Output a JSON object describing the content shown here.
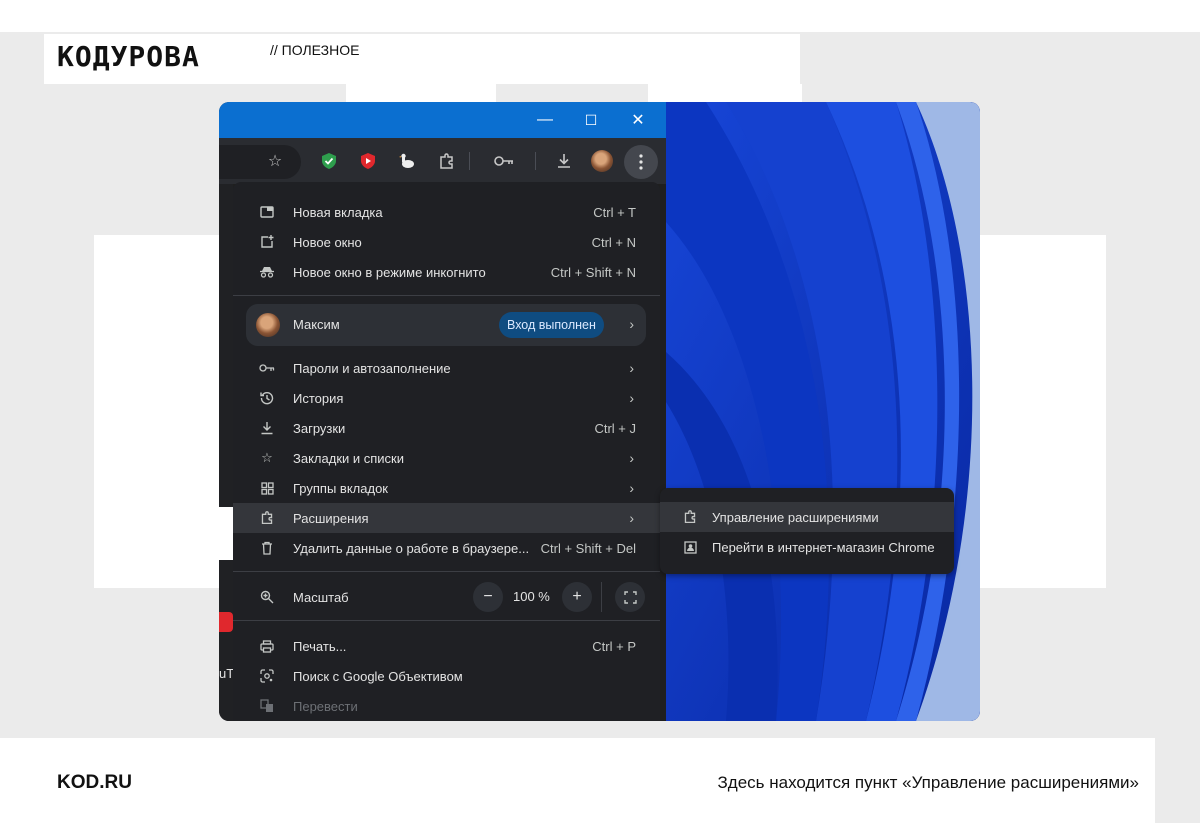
{
  "brand": {
    "logo": "KOДУРОВА",
    "tagline": "// ПОЛЕЗНОЕ"
  },
  "window": {
    "minimize_glyph": "—",
    "maximize_glyph": "☐",
    "close_glyph": "✕"
  },
  "toolbar": {
    "icons": [
      "star-icon",
      "shield-check-icon",
      "youtube-shield-icon",
      "goose-icon",
      "puzzle-icon",
      "key-icon",
      "download-icon",
      "avatar",
      "kebab-icon"
    ]
  },
  "menu": {
    "new_tab": {
      "label": "Новая вкладка",
      "shortcut": "Ctrl + T"
    },
    "new_window": {
      "label": "Новое окно",
      "shortcut": "Ctrl + N"
    },
    "incognito": {
      "label": "Новое окно в режиме инкогнито",
      "shortcut": "Ctrl + Shift + N"
    },
    "profile": {
      "name": "Максим",
      "status": "Вход выполнен"
    },
    "passwords": {
      "label": "Пароли и автозаполнение"
    },
    "history": {
      "label": "История"
    },
    "downloads": {
      "label": "Загрузки",
      "shortcut": "Ctrl + J"
    },
    "bookmarks": {
      "label": "Закладки и списки"
    },
    "tab_groups": {
      "label": "Группы вкладок"
    },
    "extensions": {
      "label": "Расширения"
    },
    "clear_data": {
      "label": "Удалить данные о работе в браузере...",
      "shortcut": "Ctrl + Shift + Del"
    },
    "zoom": {
      "label": "Масштаб",
      "value": "100 %",
      "minus": "−",
      "plus": "+"
    },
    "print": {
      "label": "Печать...",
      "shortcut": "Ctrl + P"
    },
    "lens": {
      "label": "Поиск с Google Объективом"
    },
    "translate": {
      "label": "Перевести"
    }
  },
  "submenu": {
    "manage": "Управление расширениями",
    "store": "Перейти в интернет-магазин Chrome"
  },
  "footer": {
    "site": "KOD.RU",
    "caption": "Здесь находится пункт «Управление расширениями»"
  },
  "colors": {
    "titlebar": "#0b6fd0",
    "menu_bg": "#1f2024",
    "highlight": "#34363b",
    "badge": "#0f4c81",
    "wallpaper": "#0a33b6"
  }
}
